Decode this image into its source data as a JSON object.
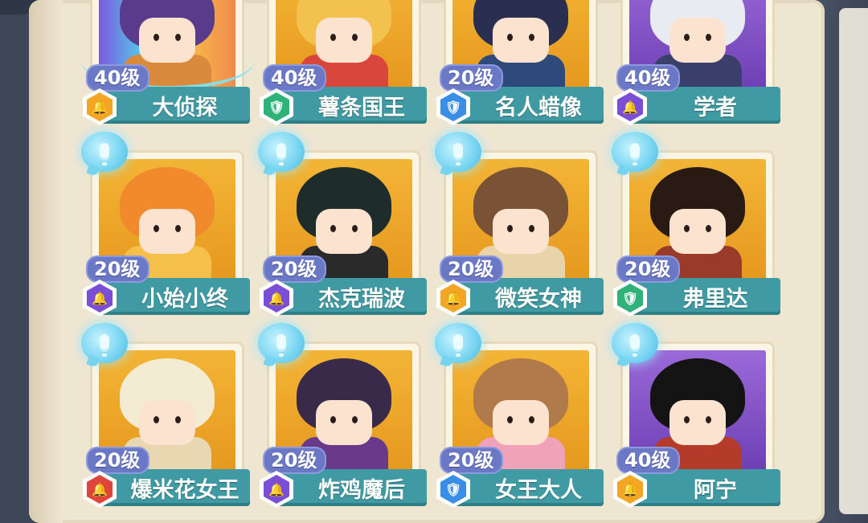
{
  "colors": {
    "badge_gold": "#f3a623",
    "badge_green": "#2fb27a",
    "badge_blue": "#3a8ee6",
    "badge_purple": "#7a4fd6",
    "badge_red": "#e0453c",
    "namebar": "#3f9aa3",
    "level_pill": "#6a78c6"
  },
  "characters": [
    {
      "level": "40级",
      "name": "大侦探",
      "badge": "gold",
      "bg": "rainbow",
      "hair": "#5a3a8a",
      "body": "#d98a3a",
      "bubble": false,
      "selected": true
    },
    {
      "level": "40级",
      "name": "薯条国王",
      "badge": "green",
      "bg": "gold",
      "hair": "#f2c14e",
      "body": "#d9463b",
      "bubble": false,
      "selected": false
    },
    {
      "level": "20级",
      "name": "名人蜡像",
      "badge": "blue",
      "bg": "gold",
      "hair": "#2a2f4f",
      "body": "#2d4a7a",
      "bubble": false,
      "selected": false
    },
    {
      "level": "40级",
      "name": "学者",
      "badge": "purple",
      "bg": "purple",
      "hair": "#e8ecf2",
      "body": "#3b3f6b",
      "bubble": false,
      "selected": false
    },
    {
      "level": "20级",
      "name": "小始小终",
      "badge": "purple",
      "bg": "gold",
      "hair": "#f08a2c",
      "body": "#f5c04a",
      "bubble": true,
      "selected": false
    },
    {
      "level": "20级",
      "name": "杰克瑞波",
      "badge": "purple",
      "bg": "gold",
      "hair": "#1f2c2c",
      "body": "#2a2a2a",
      "bubble": true,
      "selected": false
    },
    {
      "level": "20级",
      "name": "微笑女神",
      "badge": "gold",
      "bg": "gold",
      "hair": "#7a5236",
      "body": "#e8d4a8",
      "bubble": true,
      "selected": false
    },
    {
      "level": "20级",
      "name": "弗里达",
      "badge": "green",
      "bg": "gold",
      "hair": "#2a1a14",
      "body": "#9a3a2a",
      "bubble": true,
      "selected": false
    },
    {
      "level": "20级",
      "name": "爆米花女王",
      "badge": "red",
      "bg": "gold",
      "hair": "#f4ecd2",
      "body": "#e8d7b0",
      "bubble": true,
      "selected": false
    },
    {
      "level": "20级",
      "name": "炸鸡魔后",
      "badge": "purple",
      "bg": "gold",
      "hair": "#3a2a4a",
      "body": "#6a3a8a",
      "bubble": true,
      "selected": false
    },
    {
      "level": "20级",
      "name": "女王大人",
      "badge": "blue",
      "bg": "gold",
      "hair": "#b07a4a",
      "body": "#f0a3b8",
      "bubble": true,
      "selected": false
    },
    {
      "level": "40级",
      "name": "阿宁",
      "badge": "gold",
      "bg": "purple",
      "hair": "#141414",
      "body": "#b43a2a",
      "bubble": true,
      "selected": false
    }
  ]
}
